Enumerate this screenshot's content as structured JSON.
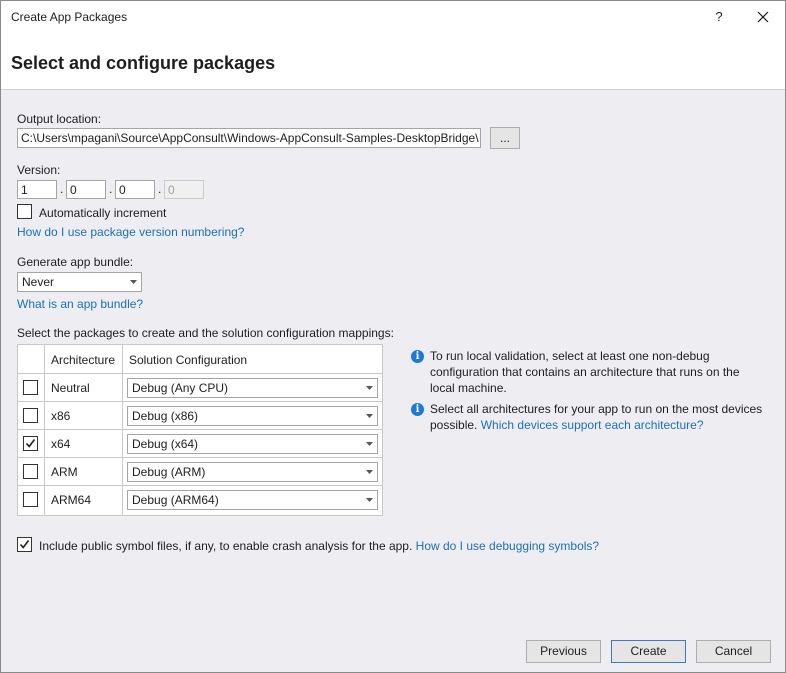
{
  "window": {
    "title": "Create App Packages",
    "help_glyph": "?",
    "close_icon": "close-icon"
  },
  "header": {
    "title": "Select and configure packages"
  },
  "output": {
    "label": "Output location:",
    "value": "C:\\Users\\mpagani\\Source\\AppConsult\\Windows-AppConsult-Samples-DesktopBridge\\",
    "browse_label": "..."
  },
  "version": {
    "label": "Version:",
    "major": "1",
    "minor": "0",
    "build": "0",
    "revision": "0",
    "separator": ".",
    "auto_increment_label": "Automatically increment",
    "auto_increment_checked": false,
    "help_link": "How do I use package version numbering?"
  },
  "bundle": {
    "label": "Generate app bundle:",
    "selected": "Never",
    "help_link": "What is an app bundle?"
  },
  "packages": {
    "label": "Select the packages to create and the solution configuration mappings:",
    "columns": [
      "Architecture",
      "Solution Configuration"
    ],
    "rows": [
      {
        "checked": false,
        "architecture": "Neutral",
        "configuration": "Debug (Any CPU)"
      },
      {
        "checked": false,
        "architecture": "x86",
        "configuration": "Debug (x86)"
      },
      {
        "checked": true,
        "architecture": "x64",
        "configuration": "Debug (x64)"
      },
      {
        "checked": false,
        "architecture": "ARM",
        "configuration": "Debug (ARM)"
      },
      {
        "checked": false,
        "architecture": "ARM64",
        "configuration": "Debug (ARM64)"
      }
    ]
  },
  "info": {
    "line1": "To run local validation, select at least one non-debug",
    "line2": "configuration that contains an architecture that runs on the",
    "line3": "local machine.",
    "line4": "Select all architectures for your app to run on the most devices",
    "line5": "possible.",
    "link": "Which devices support each architecture?"
  },
  "symbols": {
    "checked": true,
    "label": "Include public symbol files, if any, to enable crash analysis for the app.",
    "link": "How do I use debugging symbols?"
  },
  "footer": {
    "previous_label": "Previous",
    "create_label": "Create",
    "cancel_label": "Cancel"
  },
  "colors": {
    "link": "#1e6fb8",
    "background": "#eeeef2",
    "info_icon": "#1e78d8",
    "primary_button_border": "#3e79c8"
  }
}
